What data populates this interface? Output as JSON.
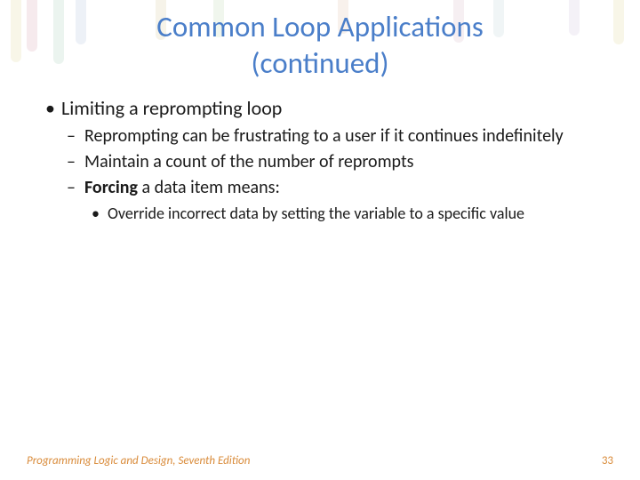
{
  "title_line1": "Common Loop Applications",
  "title_line2": "(continued)",
  "bullets": {
    "l1_item1": "Limiting a reprompting loop",
    "l2_item1": "Reprompting can be frustrating to a user if it continues indefinitely",
    "l2_item2": "Maintain a count of the number of reprompts",
    "l2_item3_bold": "Forcing",
    "l2_item3_rest": " a data item means:",
    "l3_item1": "Override incorrect data by setting the variable to a specific value"
  },
  "footer": {
    "text": "Programming Logic and Design, Seventh Edition",
    "page": "33"
  }
}
